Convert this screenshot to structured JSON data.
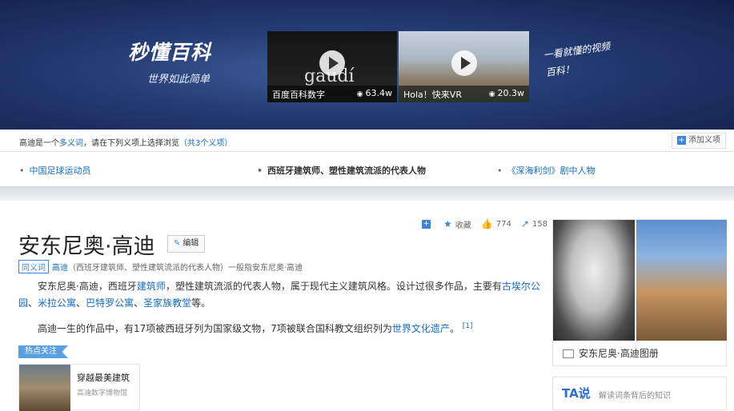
{
  "banner": {
    "logo": "秒懂百科",
    "slogan": "世界如此简单",
    "videos": [
      {
        "brand": "gaudí",
        "title": "百度百科数字",
        "views": "63.4w"
      },
      {
        "title": "Hola！快来VR",
        "views": "20.3w"
      }
    ],
    "handwritten": "一看就懂的视频百科！"
  },
  "disambiguation": {
    "prefix": "高迪是一个",
    "link_word": "多义词",
    "middle": "，请在下列义项上选择浏览",
    "count": "（共3个义项）",
    "add_button": "添加义项",
    "senses": [
      {
        "label": "中国足球运动员",
        "current": false
      },
      {
        "label": "西班牙建筑师、塑性建筑流派的代表人物",
        "current": true
      },
      {
        "label": "《深海利剑》剧中人物",
        "current": false
      }
    ]
  },
  "actions": {
    "collect": "收藏",
    "likes": "774",
    "shares": "158"
  },
  "article": {
    "title": "安东尼奥·高迪",
    "edit": "编辑",
    "sense_tag": "同义词",
    "sense_word": "高迪",
    "sense_rest": "（西班牙建筑师、塑性建筑流派的代表人物）一般指安东尼奥·高迪",
    "para1": {
      "a": "安东尼奥·高迪，西班牙",
      "link1": "建筑师",
      "b": "，塑性建筑流派的代表人物，属于现代主义建筑风格。设计过很多作品，主要有",
      "link2": "古埃尔公园",
      "sep1": "、",
      "link3": "米拉公寓",
      "sep2": "、",
      "link4": "巴特罗公寓",
      "sep3": "、",
      "link5": "圣家族教堂",
      "c": "等。"
    },
    "para2": {
      "a": "高迪一生的作品中，有17项被西班牙列为国家级文物，7项被联合国科教文组织列为",
      "link": "世界文化遗产",
      "b": "。",
      "cite": "[1]"
    }
  },
  "hot": {
    "label": "热点关注",
    "card_title": "穿越最美建筑",
    "card_sub": "高迪数字博物馆"
  },
  "gallery": {
    "caption": "安东尼奥·高迪图册"
  },
  "ta": {
    "logo": "TA说",
    "desc": "解读词条背后的知识"
  }
}
